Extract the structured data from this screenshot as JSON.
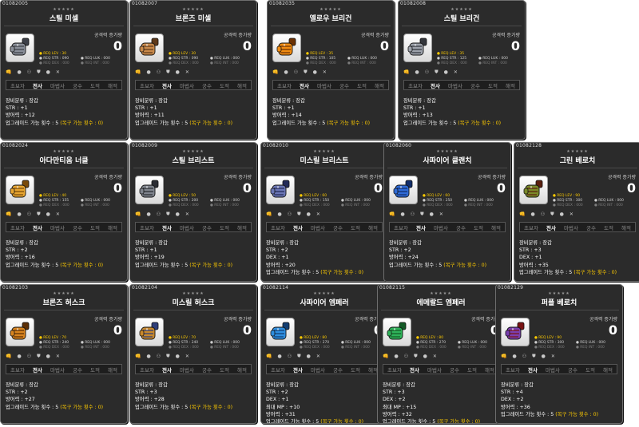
{
  "colors": {
    "card_bg": "#2b2b2b",
    "highlight": "#ffcc00",
    "dim_text": "#7c7c7c"
  },
  "labels": {
    "stars": "★★★★★",
    "atk_label": "공격력 증가량",
    "atk_value": "0",
    "req_lev_prefix": "● REQ LEV : ",
    "req_str_prefix": "● REQ STR : ",
    "req_dex": "● REQ DEX : 000",
    "req_luk": "● REQ LUK : 000",
    "req_int": "● REQ INT : 000",
    "icons": [
      "👊",
      "●",
      "⚇",
      "⛊",
      "●",
      "✕"
    ],
    "jobs": [
      "초보자",
      "전사",
      "마법사",
      "궁수",
      "도적",
      "해적"
    ],
    "category": "장비분류 : 장갑",
    "upgrade_prefix": "업그레이드 가능 횟수 : 5",
    "upgrade_recover": "(복구 가능 횟수 : 0)"
  },
  "cards": [
    {
      "code": "01082005",
      "name": "스틸 미셀",
      "req_lev": "30",
      "req_str": "090",
      "stats": [
        "STR : +1",
        "방어력 : +12"
      ],
      "color": "#8a8f99",
      "dark": "#3d4048"
    },
    {
      "code": "01082007",
      "name": "브론즈 미셀",
      "req_lev": "30",
      "req_str": "090",
      "stats": [
        "STR : +1",
        "방어력 : +11"
      ],
      "color": "#c98a4c",
      "dark": "#5e3a1b"
    },
    {
      "code": "01082035",
      "name": "옐로우 브리건",
      "req_lev": "35",
      "req_str": "105",
      "stats": [
        "STR : +1",
        "방어력 : +14"
      ],
      "color": "#f08c12",
      "dark": "#6b3104"
    },
    {
      "code": "01082008",
      "name": "스틸 브리건",
      "req_lev": "35",
      "req_str": "125",
      "stats": [
        "STR : +1",
        "방어력 : +13"
      ],
      "color": "#9da2ab",
      "dark": "#33363c"
    },
    {
      "code": "01082024",
      "name": "아다만티움 너클",
      "req_lev": "40",
      "req_str": "155",
      "stats": [
        "STR : +2",
        "방어력 : +16"
      ],
      "color": "#e7a531",
      "dark": "#7a4a08"
    },
    {
      "code": "01082009",
      "name": "스틸 브리스트",
      "req_lev": "50",
      "req_str": "200",
      "stats": [
        "STR : +1",
        "방어력 : +19"
      ],
      "color": "#7f848d",
      "dark": "#2b2d33"
    },
    {
      "code": "01082010",
      "name": "미스릴 브리스트",
      "req_lev": "60",
      "req_str": "150",
      "stats": [
        "STR : +2",
        "DEX : +1",
        "방어력 : +20"
      ],
      "color": "#6b76b5",
      "dark": "#232a57"
    },
    {
      "code": "01082060",
      "name": "사파이어 클랜치",
      "req_lev": "60",
      "req_str": "250",
      "stats": [
        "STR : +2",
        "방어력 : +24"
      ],
      "color": "#2f6bd6",
      "dark": "#122e6a"
    },
    {
      "code": "01082128",
      "name": "그린 베로치",
      "req_lev": "90",
      "req_str": "300",
      "stats": [
        "STR : +3",
        "DEX : +1",
        "방어력 : +35"
      ],
      "color": "#7b8a2a",
      "dark": "#5a1f0e"
    },
    {
      "code": "01082103",
      "name": "브론즈 허스크",
      "req_lev": "70",
      "req_str": "240",
      "stats": [
        "STR : +2",
        "방어력 : +27"
      ],
      "color": "#d8841f",
      "dark": "#5b2e05"
    },
    {
      "code": "01082104",
      "name": "미스릴 허스크",
      "req_lev": "70",
      "req_str": "240",
      "stats": [
        "STR : +3",
        "방어력 : +28"
      ],
      "color": "#c9892d",
      "dark": "#2f3f7a"
    },
    {
      "code": "01082114",
      "name": "사파이어 엠페러",
      "req_lev": "80",
      "req_str": "270",
      "stats": [
        "STR : +2",
        "DEX : +1",
        "최대 MP : +10",
        "방어력 : +31"
      ],
      "color": "#2f8fe0",
      "dark": "#123e72"
    },
    {
      "code": "01082115",
      "name": "에메랄드 엠페러",
      "req_lev": "80",
      "req_str": "270",
      "stats": [
        "STR : +3",
        "DEX : +2",
        "최대 MP : +15",
        "방어력 : +32"
      ],
      "color": "#2fb45a",
      "dark": "#135a26"
    },
    {
      "code": "01082129",
      "name": "퍼플 베로치",
      "req_lev": "90",
      "req_str": "300",
      "stats": [
        "STR : +4",
        "DEX : +2",
        "방어력 : +36"
      ],
      "color": "#7a3fb0",
      "dark": "#7a1414"
    }
  ]
}
